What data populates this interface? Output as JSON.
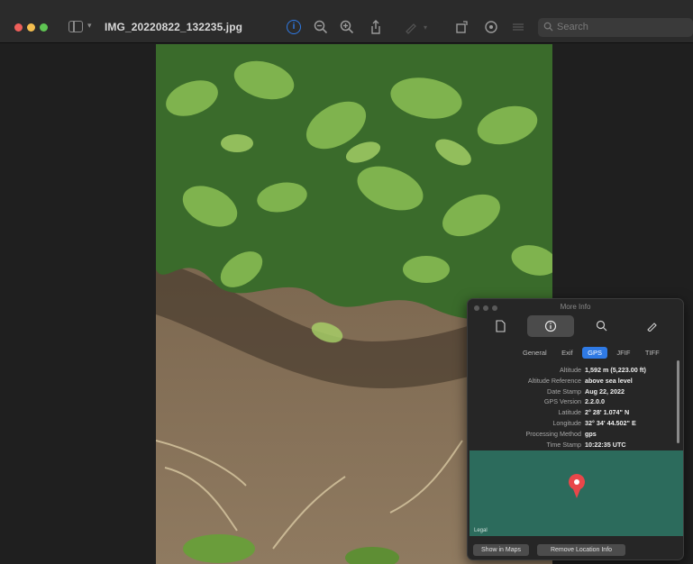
{
  "window": {
    "title": "IMG_20220822_132235.jpg"
  },
  "toolbar": {
    "search_placeholder": "Search",
    "icons": [
      "sidebar-icon",
      "info-icon",
      "zoom-out-icon",
      "zoom-in-icon",
      "share-icon",
      "markup-icon",
      "rotate-icon",
      "crop-icon",
      "highlight-icon",
      "search-icon"
    ]
  },
  "inspector": {
    "title": "More Info",
    "tabs": [
      "general-icon",
      "info-icon",
      "search-icon",
      "markup-icon"
    ],
    "segments": [
      "General",
      "Exif",
      "GPS",
      "JFIF",
      "TIFF"
    ],
    "active_segment": "GPS",
    "fields": [
      {
        "key": "Altitude",
        "value": "1,592 m (5,223.00 ft)"
      },
      {
        "key": "Altitude Reference",
        "value": "above sea level"
      },
      {
        "key": "Date Stamp",
        "value": "Aug 22, 2022"
      },
      {
        "key": "GPS Version",
        "value": "2.2.0.0"
      },
      {
        "key": "Latitude",
        "value": "2° 28' 1.074\" N"
      },
      {
        "key": "Longitude",
        "value": "32° 34' 44.502\" E"
      },
      {
        "key": "Processing Method",
        "value": "gps"
      },
      {
        "key": "Time Stamp",
        "value": "10:22:35 UTC"
      }
    ],
    "map_legal": "Legal",
    "buttons": {
      "show_in_maps": "Show in Maps",
      "remove_location": "Remove Location Info"
    }
  },
  "colors": {
    "accent": "#2f7ae5",
    "map": "#2c6b5c",
    "pin": "#e8474a"
  }
}
